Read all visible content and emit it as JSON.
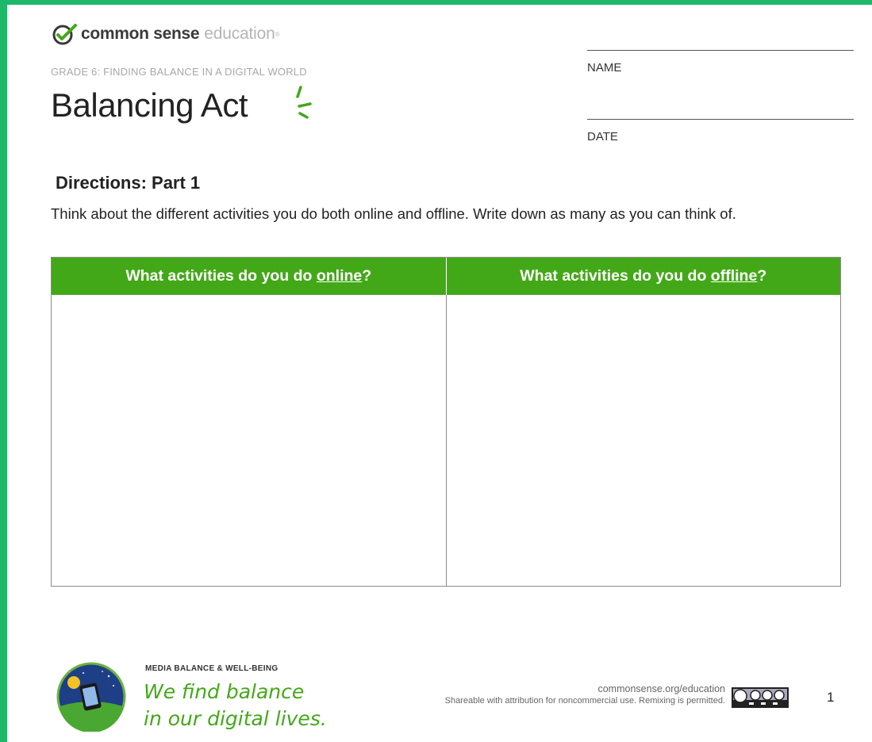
{
  "header": {
    "brand_strong": "common sense",
    "brand_light": "education",
    "grade_line": "GRADE 6: FINDING BALANCE IN A DIGITAL WORLD",
    "title": "Balancing Act"
  },
  "fields": {
    "name_label": "NAME",
    "date_label": "DATE"
  },
  "directions": {
    "heading": "Directions: Part 1",
    "text": "Think about the different activities you do both online and offline. Write down as many as you can think of."
  },
  "table": {
    "col1": {
      "prefix": "What activities do you do ",
      "emph": "online",
      "suffix": "?"
    },
    "col2": {
      "prefix": "What activities do you do ",
      "emph": "offline",
      "suffix": "?"
    }
  },
  "footer": {
    "category": "MEDIA BALANCE & WELL-BEING",
    "slogan_line1": "We find balance",
    "slogan_line2": "in our digital lives.",
    "site": "commonsense.org/education",
    "license_text": "Shareable with attribution for noncommercial use. Remixing is permitted.",
    "page_number": "1"
  },
  "colors": {
    "frame": "#1db86a",
    "accent_green": "#43a818",
    "brand_gray": "#b5b5b5"
  },
  "icons": [
    "checkmark-logo-icon",
    "sparkle-icon",
    "tablet-badge-icon",
    "creative-commons-icon"
  ]
}
